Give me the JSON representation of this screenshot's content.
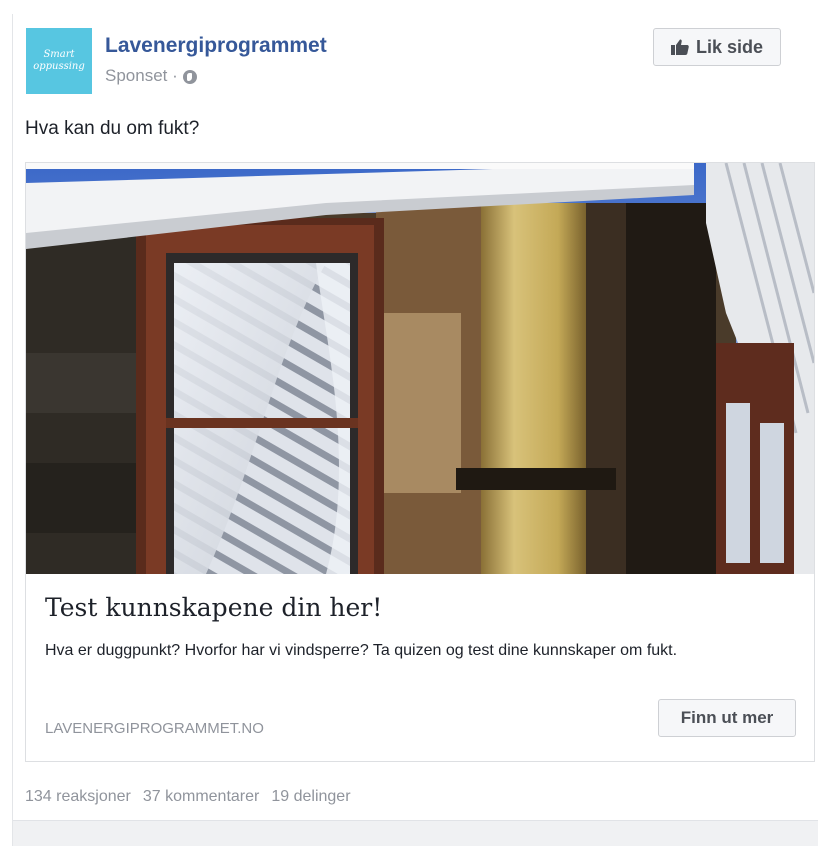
{
  "post": {
    "page_name": "Lavenergiprogrammet",
    "logo_text_line1": "Smart",
    "logo_text_line2": "oppussing",
    "sponsored_label": "Sponset ·",
    "privacy_icon": "globe-icon",
    "like_page_label": "Lik side",
    "like_icon": "thumbs-up-icon",
    "text": "Hva kan du om fukt?"
  },
  "attachment": {
    "image_subject": "house-wall-moisture-damage",
    "title": "Test kunnskapene din her!",
    "description": "Hva er duggpunkt? Hvorfor har vi vindsperre? Ta quizen og test dine kunnskaper om fukt.",
    "domain": "LAVENERGIPROGRAMMET.NO",
    "cta_label": "Finn ut mer"
  },
  "engagement": {
    "reactions": "134 reaksjoner",
    "comments": "37 kommentarer",
    "shares": "19 delinger"
  },
  "colors": {
    "page_name": "#365899",
    "logo_bg": "#57c6e1",
    "muted_text": "#90949c",
    "button_bg": "#f6f7f9"
  }
}
